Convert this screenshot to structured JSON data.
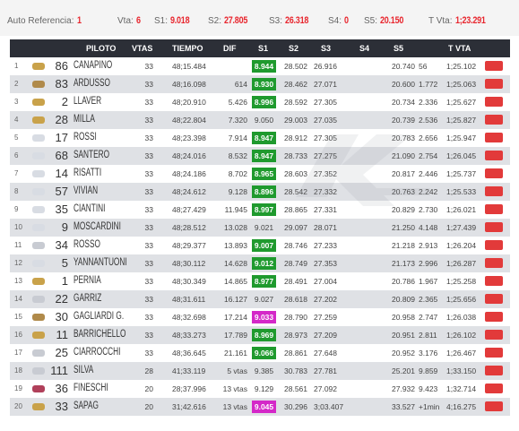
{
  "header": {
    "ref_label": "Auto Referencia:",
    "ref_value": "1",
    "vta_label": "Vta:",
    "vta_value": "6",
    "s1_label": "S1:",
    "s1_value": "9.018",
    "s2_label": "S2:",
    "s2_value": "27.805",
    "s3_label": "S3:",
    "s3_value": "26.318",
    "s4_label": "S4:",
    "s4_value": "0",
    "s5_label": "S5:",
    "s5_value": "20.150",
    "tvta_label": "T Vta:",
    "tvta_value": "1;23.291"
  },
  "columns": {
    "piloto": "PILOTO",
    "vtas": "VTAS",
    "tiempo": "TIEMPO",
    "dif": "DIF",
    "s1": "S1",
    "s2": "S2",
    "s3": "S3",
    "s4": "S4",
    "s5": "S5",
    "tvta": "T VTA"
  },
  "colors": {
    "accent_red": "#e8262e",
    "best_green": "#1f9a2e",
    "best_magenta": "#d428c8",
    "header_bg": "#2c2f37"
  },
  "rows": [
    {
      "pos": "1",
      "num": "86",
      "name": "CANAPINO",
      "vtas": "33",
      "tiempo": "48;15.484",
      "dif": "",
      "s1": "8.944",
      "s1_mark": "green",
      "s2": "28.502",
      "s3": "26.916",
      "s4": "",
      "s5": "20.740",
      "gap": "56",
      "tvta": "1;25.102",
      "brand_color": "#c9a24a"
    },
    {
      "pos": "2",
      "num": "83",
      "name": "ARDUSSO",
      "vtas": "33",
      "tiempo": "48;16.098",
      "dif": "614",
      "s1": "8.930",
      "s1_mark": "green",
      "s2": "28.462",
      "s3": "27.071",
      "s4": "",
      "s5": "20.600",
      "gap": "1.772",
      "tvta": "1;25.063",
      "brand_color": "#b08a4a"
    },
    {
      "pos": "3",
      "num": "2",
      "name": "LLAVER",
      "vtas": "33",
      "tiempo": "48;20.910",
      "dif": "5.426",
      "s1": "8.996",
      "s1_mark": "green",
      "s2": "28.592",
      "s3": "27.305",
      "s4": "",
      "s5": "20.734",
      "gap": "2.336",
      "tvta": "1;25.627",
      "brand_color": "#c9a24a"
    },
    {
      "pos": "4",
      "num": "28",
      "name": "MILLA",
      "vtas": "33",
      "tiempo": "48;22.804",
      "dif": "7.320",
      "s1": "9.050",
      "s1_mark": "",
      "s2": "29.003",
      "s3": "27.035",
      "s4": "",
      "s5": "20.739",
      "gap": "2.536",
      "tvta": "1;25.827",
      "brand_color": "#c9a24a"
    },
    {
      "pos": "5",
      "num": "17",
      "name": "ROSSI",
      "vtas": "33",
      "tiempo": "48;23.398",
      "dif": "7.914",
      "s1": "8.947",
      "s1_mark": "green",
      "s2": "28.912",
      "s3": "27.305",
      "s4": "",
      "s5": "20.783",
      "gap": "2.656",
      "tvta": "1;25.947",
      "brand_color": "#d8dce3"
    },
    {
      "pos": "6",
      "num": "68",
      "name": "SANTERO",
      "vtas": "33",
      "tiempo": "48;24.016",
      "dif": "8.532",
      "s1": "8.947",
      "s1_mark": "green",
      "s2": "28.733",
      "s3": "27.275",
      "s4": "",
      "s5": "21.090",
      "gap": "2.754",
      "tvta": "1;26.045",
      "brand_color": "#d8dce3"
    },
    {
      "pos": "7",
      "num": "14",
      "name": "RISATTI",
      "vtas": "33",
      "tiempo": "48;24.186",
      "dif": "8.702",
      "s1": "8.965",
      "s1_mark": "green",
      "s2": "28.603",
      "s3": "27.352",
      "s4": "",
      "s5": "20.817",
      "gap": "2.446",
      "tvta": "1;25.737",
      "brand_color": "#d8dce3"
    },
    {
      "pos": "8",
      "num": "57",
      "name": "VIVIAN",
      "vtas": "33",
      "tiempo": "48;24.612",
      "dif": "9.128",
      "s1": "8.896",
      "s1_mark": "green",
      "s2": "28.542",
      "s3": "27.332",
      "s4": "",
      "s5": "20.763",
      "gap": "2.242",
      "tvta": "1;25.533",
      "brand_color": "#d8dce3"
    },
    {
      "pos": "9",
      "num": "35",
      "name": "CIANTINI",
      "vtas": "33",
      "tiempo": "48;27.429",
      "dif": "11.945",
      "s1": "8.997",
      "s1_mark": "green",
      "s2": "28.865",
      "s3": "27.331",
      "s4": "",
      "s5": "20.829",
      "gap": "2.730",
      "tvta": "1;26.021",
      "brand_color": "#d8dce3"
    },
    {
      "pos": "10",
      "num": "9",
      "name": "MOSCARDINI",
      "vtas": "33",
      "tiempo": "48;28.512",
      "dif": "13.028",
      "s1": "9.021",
      "s1_mark": "",
      "s2": "29.097",
      "s3": "28.071",
      "s4": "",
      "s5": "21.250",
      "gap": "4.148",
      "tvta": "1;27.439",
      "brand_color": "#d8dce3"
    },
    {
      "pos": "11",
      "num": "34",
      "name": "ROSSO",
      "vtas": "33",
      "tiempo": "48;29.377",
      "dif": "13.893",
      "s1": "9.007",
      "s1_mark": "green",
      "s2": "28.746",
      "s3": "27.233",
      "s4": "",
      "s5": "21.218",
      "gap": "2.913",
      "tvta": "1;26.204",
      "brand_color": "#c8cbd2"
    },
    {
      "pos": "12",
      "num": "5",
      "name": "YANNANTUONI",
      "vtas": "33",
      "tiempo": "48;30.112",
      "dif": "14.628",
      "s1": "9.012",
      "s1_mark": "green",
      "s2": "28.749",
      "s3": "27.353",
      "s4": "",
      "s5": "21.173",
      "gap": "2.996",
      "tvta": "1;26.287",
      "brand_color": "#d8dce3"
    },
    {
      "pos": "13",
      "num": "1",
      "name": "PERNIA",
      "vtas": "33",
      "tiempo": "48;30.349",
      "dif": "14.865",
      "s1": "8.977",
      "s1_mark": "green",
      "s2": "28.491",
      "s3": "27.004",
      "s4": "",
      "s5": "20.786",
      "gap": "1.967",
      "tvta": "1;25.258",
      "brand_color": "#c9a24a"
    },
    {
      "pos": "14",
      "num": "22",
      "name": "GARRIZ",
      "vtas": "33",
      "tiempo": "48;31.611",
      "dif": "16.127",
      "s1": "9.027",
      "s1_mark": "",
      "s2": "28.618",
      "s3": "27.202",
      "s4": "",
      "s5": "20.809",
      "gap": "2.365",
      "tvta": "1;25.656",
      "brand_color": "#c8cbd2"
    },
    {
      "pos": "15",
      "num": "30",
      "name": "GAGLIARDI G.",
      "vtas": "33",
      "tiempo": "48;32.698",
      "dif": "17.214",
      "s1": "9.033",
      "s1_mark": "magenta",
      "s2": "28.790",
      "s3": "27.259",
      "s4": "",
      "s5": "20.958",
      "gap": "2.747",
      "tvta": "1;26.038",
      "brand_color": "#b08a4a"
    },
    {
      "pos": "16",
      "num": "11",
      "name": "BARRICHELLO",
      "vtas": "33",
      "tiempo": "48;33.273",
      "dif": "17.789",
      "s1": "8.969",
      "s1_mark": "green",
      "s2": "28.973",
      "s3": "27.209",
      "s4": "",
      "s5": "20.951",
      "gap": "2.811",
      "tvta": "1;26.102",
      "brand_color": "#c9a24a"
    },
    {
      "pos": "17",
      "num": "25",
      "name": "CIARROCCHI",
      "vtas": "33",
      "tiempo": "48;36.645",
      "dif": "21.161",
      "s1": "9.066",
      "s1_mark": "green",
      "s2": "28.861",
      "s3": "27.648",
      "s4": "",
      "s5": "20.952",
      "gap": "3.176",
      "tvta": "1;26.467",
      "brand_color": "#c8cbd2"
    },
    {
      "pos": "18",
      "num": "111",
      "name": "SILVA",
      "vtas": "28",
      "tiempo": "41;33.119",
      "dif": "5 vtas",
      "s1": "9.385",
      "s1_mark": "",
      "s2": "30.783",
      "s3": "27.781",
      "s4": "",
      "s5": "25.201",
      "gap": "9.859",
      "tvta": "1;33.150",
      "brand_color": "#c8cbd2"
    },
    {
      "pos": "19",
      "num": "36",
      "name": "FINESCHI",
      "vtas": "20",
      "tiempo": "28;37.996",
      "dif": "13 vtas",
      "s1": "9.129",
      "s1_mark": "",
      "s2": "28.561",
      "s3": "27.092",
      "s4": "",
      "s5": "27.932",
      "gap": "9.423",
      "tvta": "1;32.714",
      "brand_color": "#b0405a"
    },
    {
      "pos": "20",
      "num": "33",
      "name": "SAPAG",
      "vtas": "20",
      "tiempo": "31;42.616",
      "dif": "13 vtas",
      "s1": "9.045",
      "s1_mark": "magenta",
      "s2": "30.296",
      "s3": "3;03.407",
      "s4": "",
      "s5": "33.527",
      "gap": "+1min",
      "tvta": "4;16.275",
      "brand_color": "#c9a24a"
    }
  ]
}
